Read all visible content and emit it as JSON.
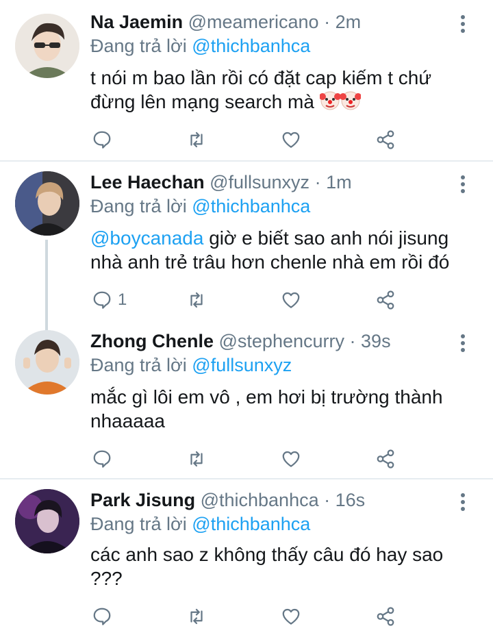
{
  "reply_prefix": "Đang trả lời",
  "tweets": [
    {
      "name": "Na Jaemin",
      "handle": "@meamericano",
      "separator": "·",
      "time": "2m",
      "reply_to": "@thichbanhca",
      "text": "t nói m bao lần rồi có đặt cap kiếm t chứ đừng lên mạng search mà",
      "emoji": "clown-face, clown-face",
      "reply_count": ""
    },
    {
      "name": "Lee Haechan",
      "handle": "@fullsunxyz",
      "separator": "·",
      "time": "1m",
      "reply_to": "@thichbanhca",
      "text_mention": "@boycanada",
      "text": " giờ e biết sao anh nói jisung nhà anh trẻ trâu hơn chenle nhà em rồi đó",
      "reply_count": "1"
    },
    {
      "name": "Zhong Chenle",
      "handle": "@stephencurry",
      "separator": "·",
      "time": "39s",
      "reply_to": "@fullsunxyz",
      "text": "mắc gì lôi em vô , em hơi bị trường thành nhaaaaa",
      "reply_count": ""
    },
    {
      "name": "Park Jisung",
      "handle": "@thichbanhca",
      "separator": "·",
      "time": "16s",
      "reply_to": "@thichbanhca",
      "text": "các anh sao z không thấy câu đó hay sao ???",
      "reply_count": ""
    }
  ],
  "colors": {
    "accent": "#1da1f2",
    "muted": "#657786",
    "divider": "#e6ecf0"
  },
  "icons": [
    "reply-icon",
    "retweet-icon",
    "like-icon",
    "share-icon",
    "more-icon"
  ]
}
